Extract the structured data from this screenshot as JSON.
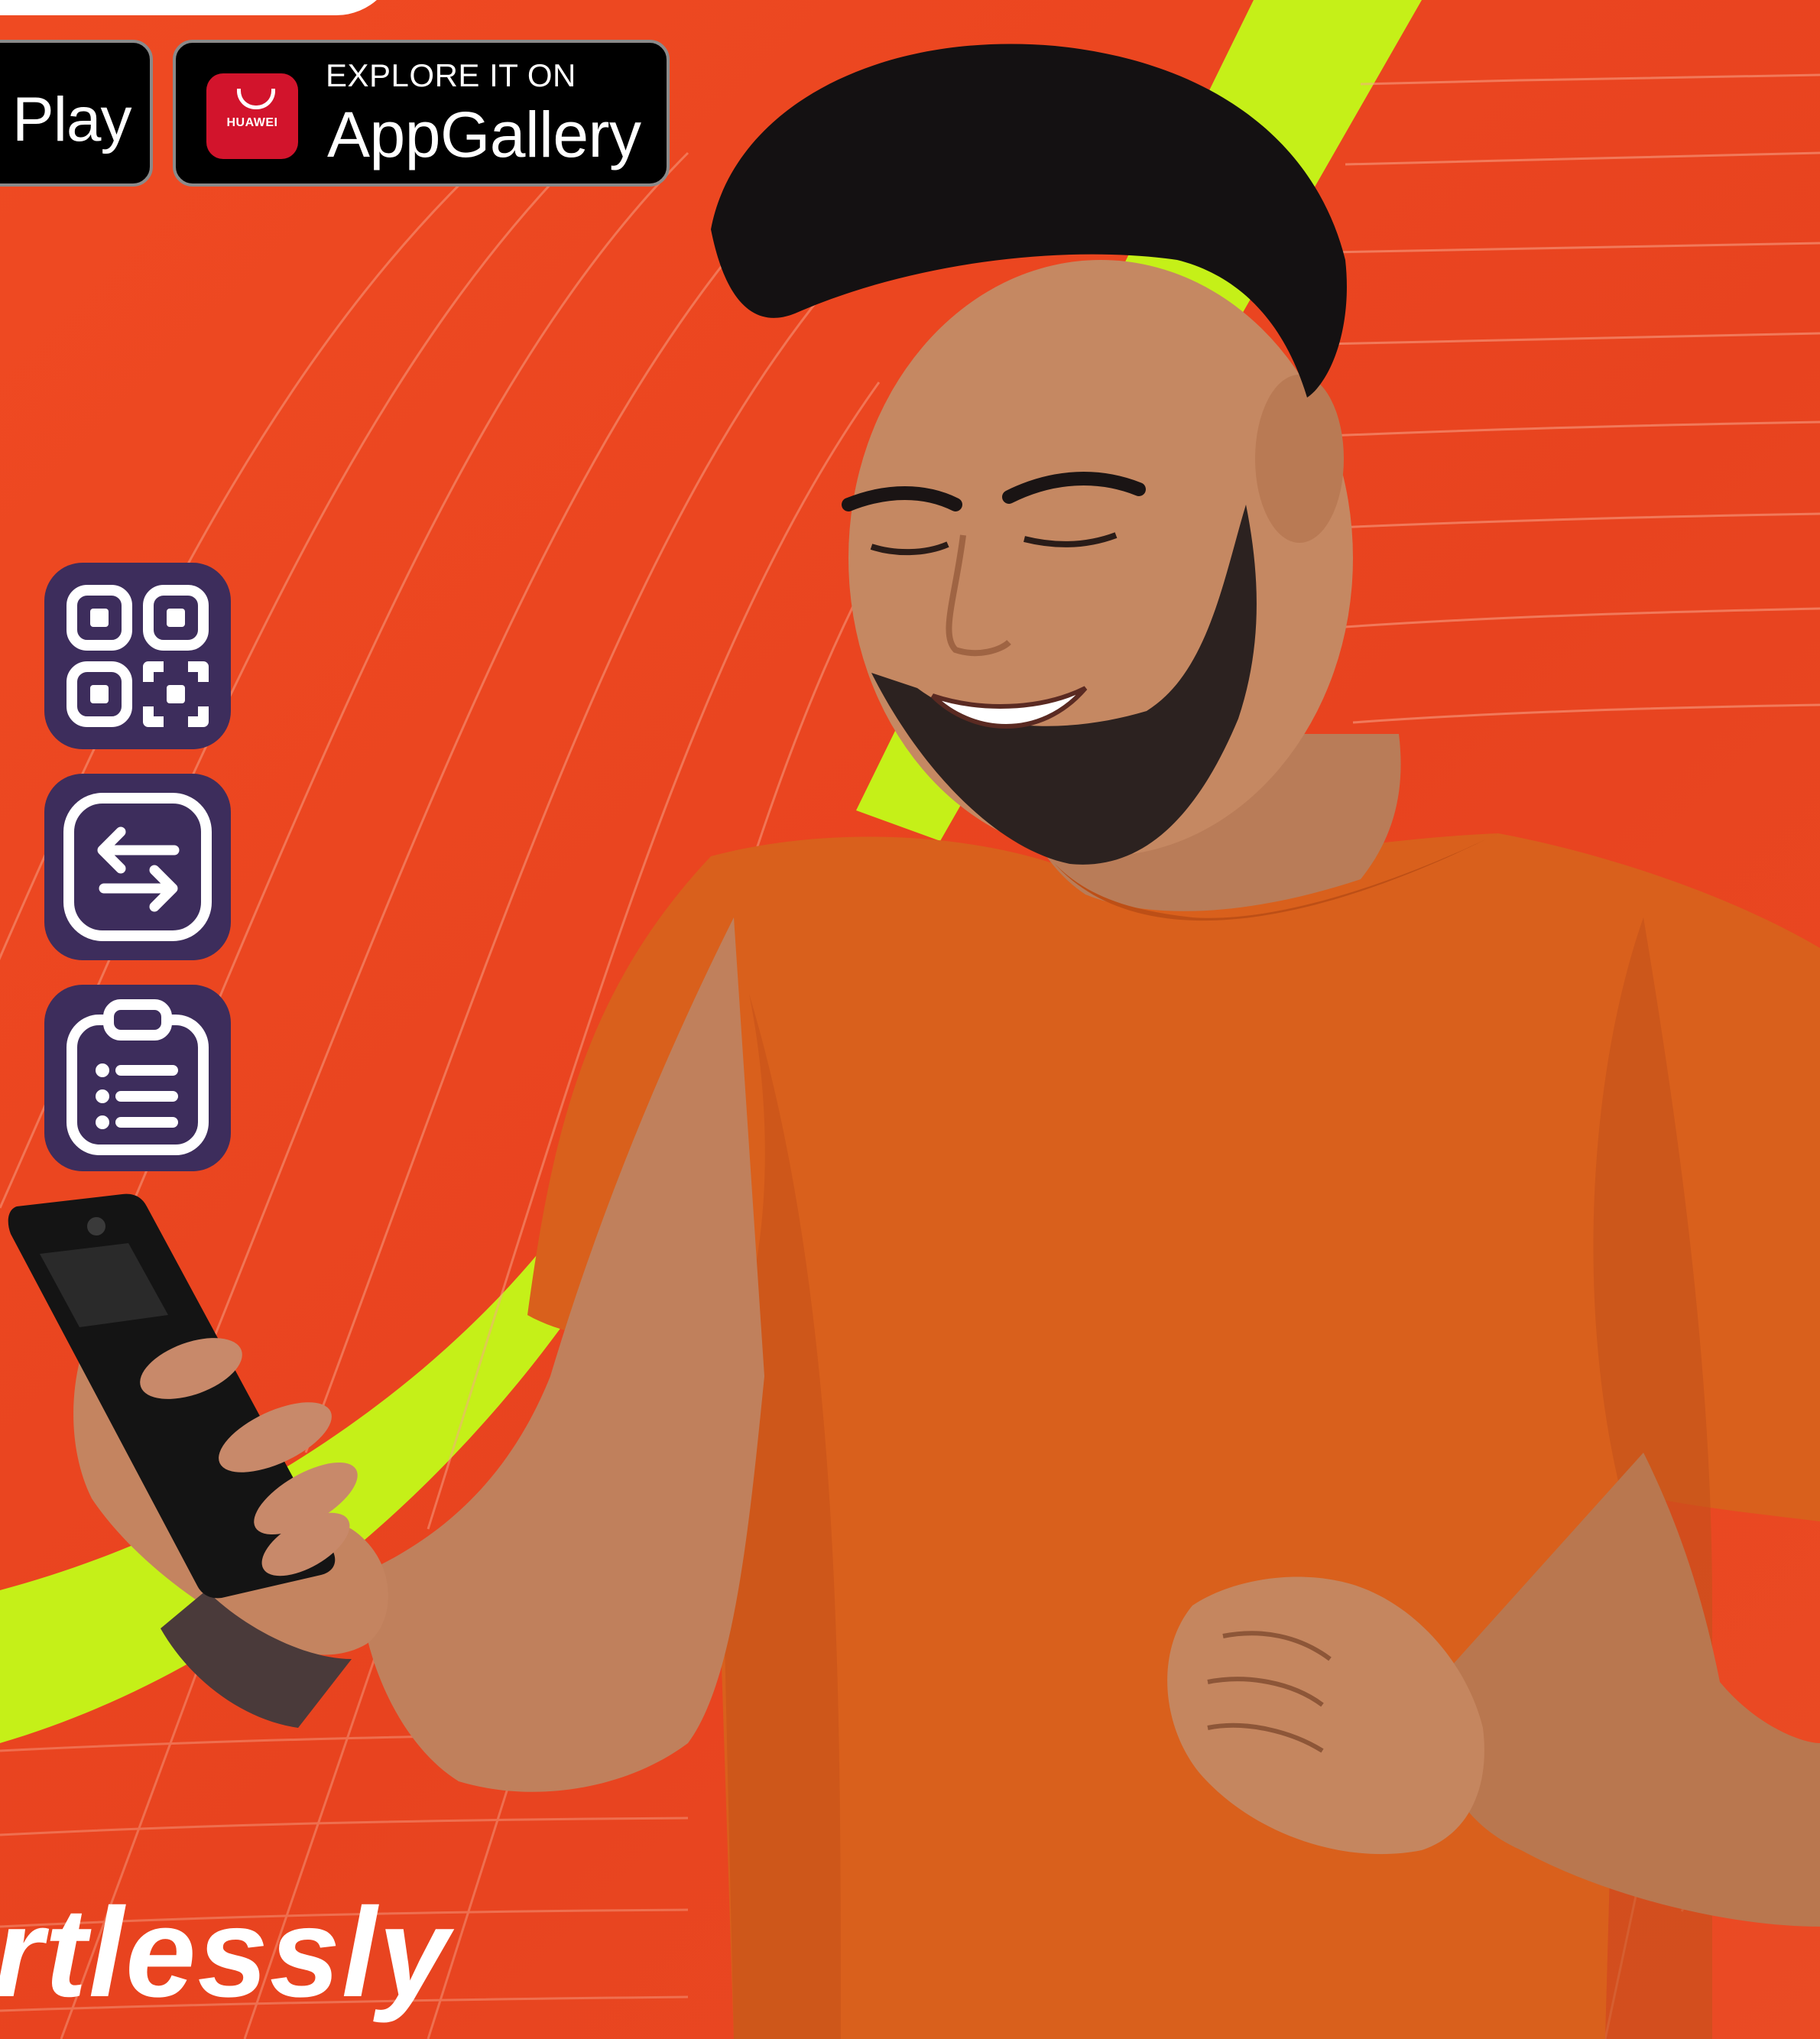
{
  "store_badges": {
    "google_play": {
      "label": "Play",
      "icon": "google-play-icon"
    },
    "app_gallery": {
      "brand": "HUAWEI",
      "explore_label": "EXPLORE IT ON",
      "store_label": "AppGallery",
      "icon": "huawei-appgallery-icon"
    }
  },
  "features": [
    {
      "icon": "qr-scan-icon"
    },
    {
      "icon": "transfer-arrows-icon"
    },
    {
      "icon": "clipboard-list-icon"
    }
  ],
  "hero": {
    "tagline": "rtlessly"
  },
  "colors": {
    "background": "#e84420",
    "accent_green": "#c5f018",
    "tile": "#3d2d5c",
    "badge": "#000000",
    "huawei_red": "#d2142c",
    "shirt": "#d9601c"
  }
}
